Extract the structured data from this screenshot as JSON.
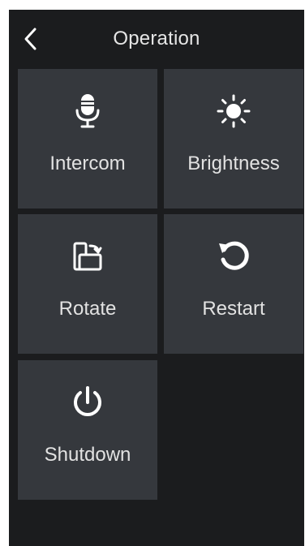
{
  "header": {
    "title": "Operation",
    "back_icon": "chevron-left-icon"
  },
  "tiles": [
    {
      "label": "Intercom",
      "icon": "microphone-icon"
    },
    {
      "label": "Brightness",
      "icon": "sun-icon"
    },
    {
      "label": "Rotate",
      "icon": "rotate-screen-icon"
    },
    {
      "label": "Restart",
      "icon": "restart-icon"
    },
    {
      "label": "Shutdown",
      "icon": "power-icon"
    }
  ],
  "colors": {
    "background": "#1b1c1e",
    "tile": "#35383d",
    "text": "#e2e2e2",
    "icon": "#ffffff"
  }
}
